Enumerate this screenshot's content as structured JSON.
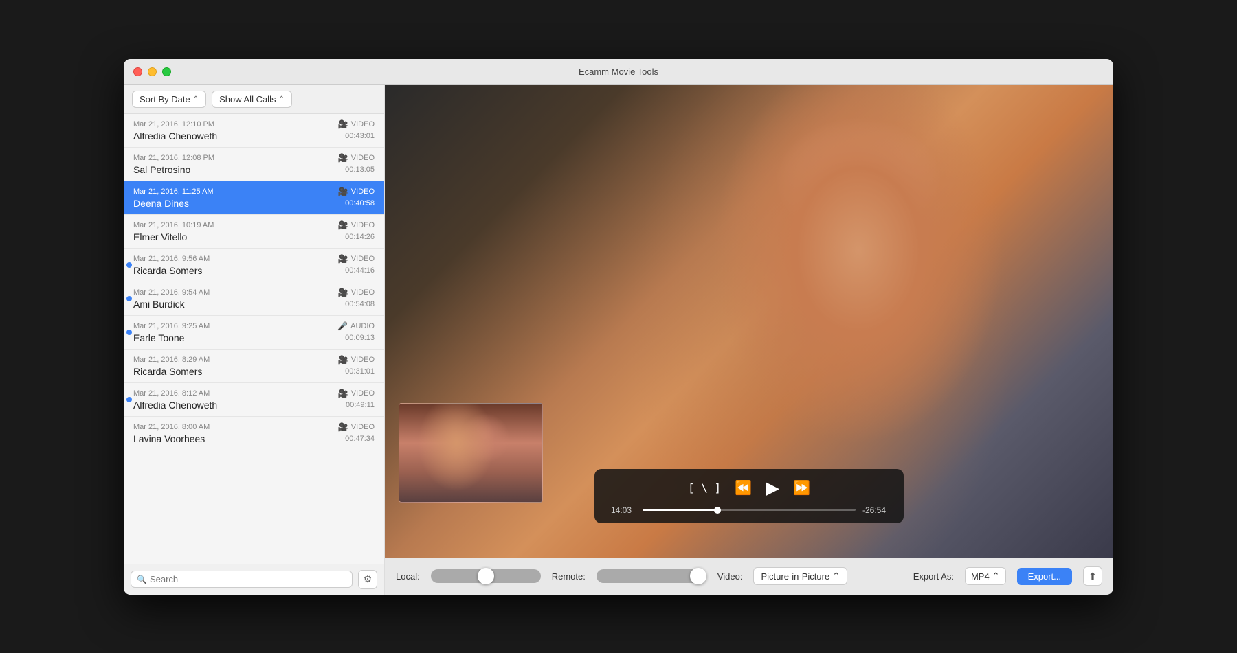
{
  "window": {
    "title": "Ecamm Movie Tools"
  },
  "sidebar": {
    "sort_label": "Sort By Date",
    "show_label": "Show All Calls",
    "calls": [
      {
        "date": "Mar 21, 2016, 12:10 PM",
        "type": "VIDEO",
        "name": "Alfredia Chenoweth",
        "duration": "00:43:01",
        "selected": false,
        "unread": false
      },
      {
        "date": "Mar 21, 2016, 12:08 PM",
        "type": "VIDEO",
        "name": "Sal Petrosino",
        "duration": "00:13:05",
        "selected": false,
        "unread": false
      },
      {
        "date": "Mar 21, 2016, 11:25 AM",
        "type": "VIDEO",
        "name": "Deena Dines",
        "duration": "00:40:58",
        "selected": true,
        "unread": false
      },
      {
        "date": "Mar 21, 2016, 10:19 AM",
        "type": "VIDEO",
        "name": "Elmer Vitello",
        "duration": "00:14:26",
        "selected": false,
        "unread": false
      },
      {
        "date": "Mar 21, 2016, 9:56 AM",
        "type": "VIDEO",
        "name": "Ricarda Somers",
        "duration": "00:44:16",
        "selected": false,
        "unread": true
      },
      {
        "date": "Mar 21, 2016, 9:54 AM",
        "type": "VIDEO",
        "name": "Ami Burdick",
        "duration": "00:54:08",
        "selected": false,
        "unread": true
      },
      {
        "date": "Mar 21, 2016, 9:25 AM",
        "type": "AUDIO",
        "name": "Earle Toone",
        "duration": "00:09:13",
        "selected": false,
        "unread": true
      },
      {
        "date": "Mar 21, 2016, 8:29 AM",
        "type": "VIDEO",
        "name": "Ricarda Somers",
        "duration": "00:31:01",
        "selected": false,
        "unread": false
      },
      {
        "date": "Mar 21, 2016, 8:12 AM",
        "type": "VIDEO",
        "name": "Alfredia Chenoweth",
        "duration": "00:49:11",
        "selected": false,
        "unread": true
      },
      {
        "date": "Mar 21, 2016, 8:00 AM",
        "type": "VIDEO",
        "name": "Lavina Voorhees",
        "duration": "00:47:34",
        "selected": false,
        "unread": false
      }
    ],
    "search_placeholder": "Search"
  },
  "player": {
    "time_current": "14:03",
    "time_remaining": "-26:54",
    "progress_percent": 35
  },
  "bottom_bar": {
    "local_label": "Local:",
    "remote_label": "Remote:",
    "video_label": "Video:",
    "video_mode": "Picture-in-Picture",
    "export_as_label": "Export As:",
    "export_format": "MP4",
    "export_button": "Export..."
  }
}
